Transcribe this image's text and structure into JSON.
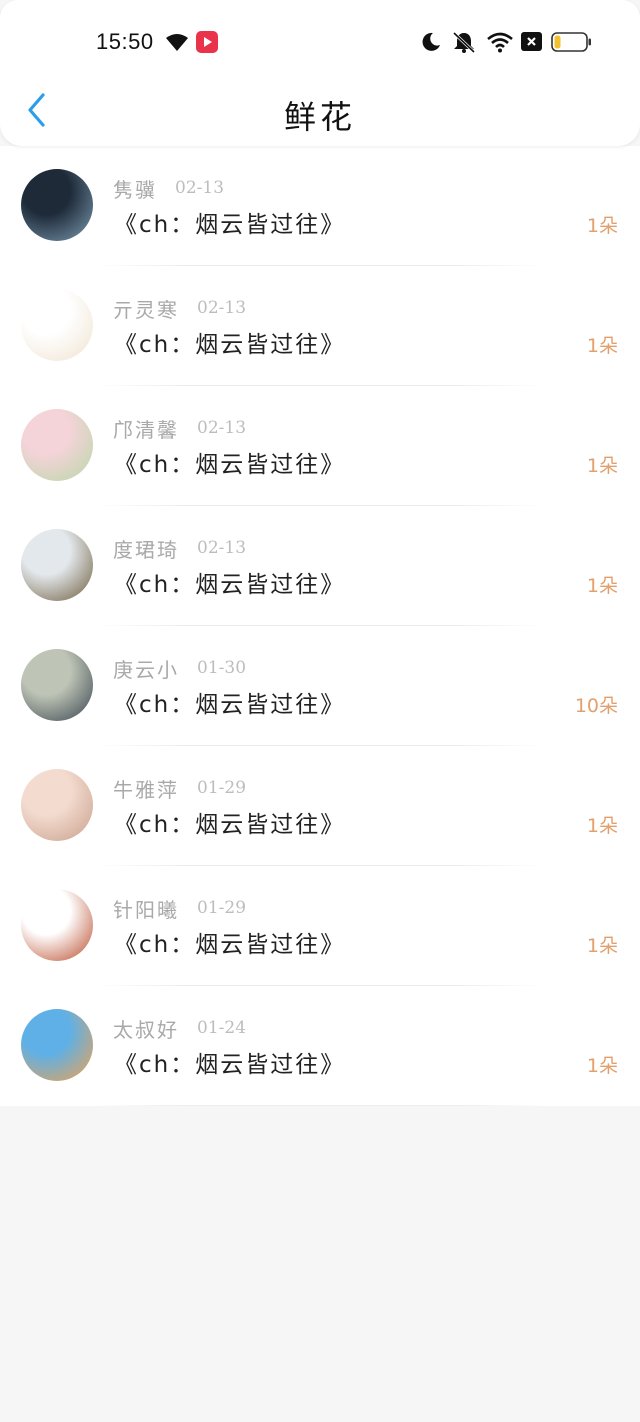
{
  "status_bar": {
    "time": "15:50",
    "left_icons": [
      "wifi-signal-icon",
      "video-app-icon"
    ],
    "right_icons": [
      "moon-icon",
      "bell-muted-icon",
      "wifi-icon",
      "sim-disabled-icon",
      "battery-icon"
    ],
    "battery_level": 0.2,
    "battery_color": "#f2c12e",
    "app_icon_color": "#e8334a"
  },
  "header": {
    "title": "鲜花",
    "back_icon": "chevron-left-icon",
    "back_color": "#2a9ee8"
  },
  "colors": {
    "count": "#e3a06d",
    "name": "#a9a9a9",
    "message": "#222222",
    "background": "#f7f6f6"
  },
  "items": [
    {
      "name": "隽骥",
      "date": "02-13",
      "message": "《ch：烟云皆过往》",
      "count": "1朵",
      "avatar_colors": [
        "#1e2a38",
        "#7d9db4"
      ]
    },
    {
      "name": "亓灵寒",
      "date": "02-13",
      "message": "《ch：烟云皆过往》",
      "count": "1朵",
      "avatar_colors": [
        "#ffffff",
        "#efe2cf"
      ]
    },
    {
      "name": "邝清馨",
      "date": "02-13",
      "message": "《ch：烟云皆过往》",
      "count": "1朵",
      "avatar_colors": [
        "#f4d3d9",
        "#b8d8a6"
      ]
    },
    {
      "name": "度珺琦",
      "date": "02-13",
      "message": "《ch：烟云皆过往》",
      "count": "1朵",
      "avatar_colors": [
        "#e3e8ec",
        "#6d5b3b"
      ]
    },
    {
      "name": "庚云小",
      "date": "01-30",
      "message": "《ch：烟云皆过往》",
      "count": "10朵",
      "avatar_colors": [
        "#bfc5b6",
        "#38444f"
      ]
    },
    {
      "name": "牛雅萍",
      "date": "01-29",
      "message": "《ch：烟云皆过往》",
      "count": "1朵",
      "avatar_colors": [
        "#f3dccf",
        "#c99e8c"
      ]
    },
    {
      "name": "针阳曦",
      "date": "01-29",
      "message": "《ch：烟云皆过往》",
      "count": "1朵",
      "avatar_colors": [
        "#ffffff",
        "#b84a2a"
      ]
    },
    {
      "name": "太叔好",
      "date": "01-24",
      "message": "《ch：烟云皆过往》",
      "count": "1朵",
      "avatar_colors": [
        "#5fb0e6",
        "#f2a24e"
      ]
    }
  ]
}
